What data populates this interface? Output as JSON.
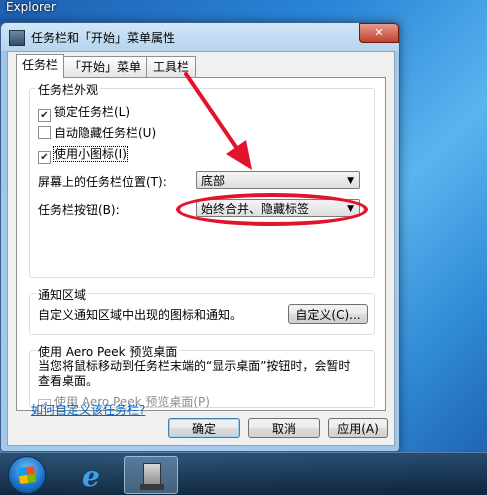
{
  "desktop": {
    "label": "Explorer"
  },
  "dialog": {
    "title": "任务栏和「开始」菜单属性",
    "close_glyph": "✕",
    "tabs": [
      {
        "label": "任务栏",
        "active": true
      },
      {
        "label": "「开始」菜单",
        "active": false
      },
      {
        "label": "工具栏",
        "active": false
      }
    ],
    "appearance": {
      "legend": "任务栏外观",
      "lock_label": "锁定任务栏(L)",
      "lock_checked": true,
      "autohide_label": "自动隐藏任务栏(U)",
      "autohide_checked": false,
      "small_icons_label": "使用小图标(I)",
      "small_icons_checked": true,
      "location_label": "屏幕上的任务栏位置(T):",
      "location_value": "底部",
      "buttons_label": "任务栏按钮(B):",
      "buttons_value": "始终合并、隐藏标签"
    },
    "notification": {
      "legend": "通知区域",
      "description": "自定义通知区域中出现的图标和通知。",
      "customize_button": "自定义(C)..."
    },
    "aero_peek": {
      "legend": "使用 Aero Peek 预览桌面",
      "description_line1": "当您将鼠标移动到任务栏末端的“显示桌面”按钮时，会暂时",
      "description_line2": "查看桌面。",
      "checkbox_label": "使用 Aero Peek 预览桌面(P)",
      "checkbox_checked": true
    },
    "help_link": "如何自定义该任务栏?",
    "buttons": {
      "ok": "确定",
      "cancel": "取消",
      "apply": "应用(A)"
    }
  },
  "check_glyph": "✔",
  "dropdown_glyph": "▼",
  "annotation": {
    "color": "#e3132b"
  }
}
